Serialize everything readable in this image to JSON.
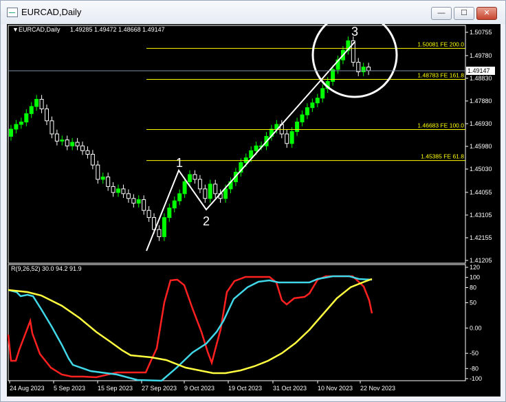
{
  "window": {
    "title": "EURCAD,Daily",
    "minimize_label": "—",
    "maximize_label": "☐",
    "close_label": "✕"
  },
  "colors": {
    "bull_candle": "#00ff00",
    "bear_candle": "#ffffff",
    "axis": "#ffffff",
    "fib_line": "#ffff00",
    "wave_line": "#ffffff",
    "red_line": "#ff2020",
    "cyan_line": "#40d8e8",
    "yellow_line": "#ffff40"
  },
  "price_panel": {
    "header_label": "EURCAD,Daily",
    "ohlc": "1.49285 1.49472 1.48668 1.49147",
    "current_price_label": "1.49147",
    "y_ticks": [
      "1.50755",
      "1.49780",
      "1.48830",
      "1.47880",
      "1.46930",
      "1.45980",
      "1.45030",
      "1.44055",
      "1.43105",
      "1.42155",
      "1.41205"
    ],
    "fib_levels": [
      {
        "label": "1.50081 FE 200.0",
        "price": 1.50081
      },
      {
        "label": "1.48783 FE 161.8",
        "price": 1.48783
      },
      {
        "label": "1.46683 FE 100.0",
        "price": 1.46683
      },
      {
        "label": "1.45385 FE 61.8",
        "price": 1.45385
      }
    ],
    "wave_labels": [
      "1",
      "2",
      "3"
    ]
  },
  "indicator_panel": {
    "header_label": "R(9,26,52) 30.0 94.2 91.9",
    "y_ticks": [
      "120",
      "100",
      "80",
      "50",
      "0.00",
      "-50",
      "-80",
      "-100"
    ]
  },
  "x_axis_labels": [
    "24 Aug 2023",
    "5 Sep 2023",
    "15 Sep 2023",
    "27 Sep 2023",
    "9 Oct 2023",
    "19 Oct 2023",
    "31 Oct 2023",
    "10 Nov 2023",
    "22 Nov 2023"
  ],
  "chart_data": {
    "type": "candlestick",
    "symbol": "EURCAD",
    "timeframe": "Daily",
    "ylim": [
      1.41205,
      1.50755
    ],
    "indicator_ylim": [
      -100,
      120
    ]
  }
}
